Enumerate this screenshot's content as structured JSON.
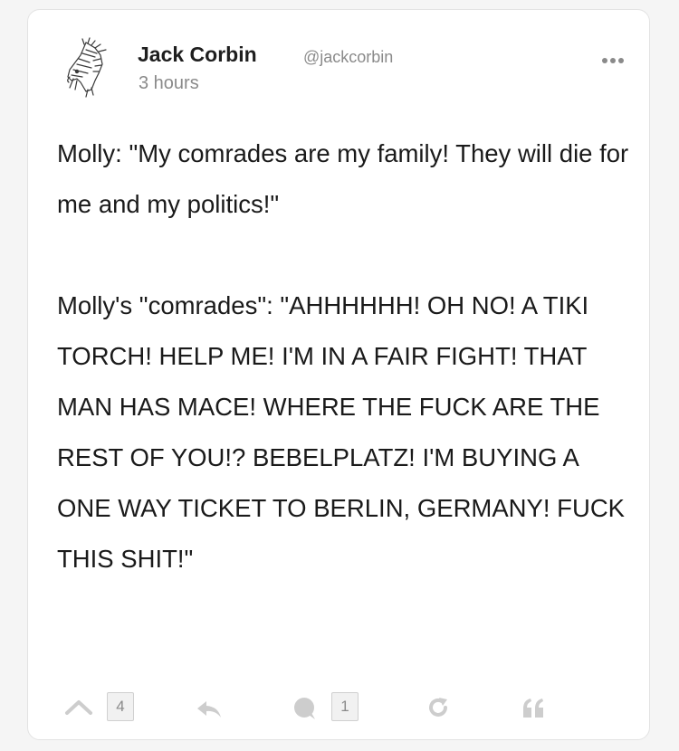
{
  "post": {
    "author_name": "Jack Corbin",
    "author_handle": "@jackcorbin",
    "timestamp": "3 hours",
    "paragraphs": [
      "Molly: \"My comrades are my family! They will die for me and my politics!\"",
      "Molly's \"comrades\": \"AHHHHHH! OH NO! A TIKI TORCH! HELP ME! I'M IN A FAIR FIGHT! THAT MAN HAS MACE! WHERE THE FUCK ARE THE REST OF YOU!? BEBELPLATZ! I'M BUYING A ONE WAY TICKET TO BERLIN, GERMANY! FUCK THIS SHIT!\""
    ]
  },
  "actions": {
    "upvote_icon": "chevron-up-icon",
    "upvote_count": "4",
    "reply_icon": "reply-icon",
    "comment_icon": "comment-icon",
    "comment_count": "1",
    "repost_icon": "repost-icon",
    "quote_icon": "quote-icon",
    "more_icon": "more-dots-icon"
  },
  "colors": {
    "icon_gray": "#cdcdcd",
    "text_primary": "#1a1a1a",
    "text_secondary": "#8a8a8a"
  }
}
